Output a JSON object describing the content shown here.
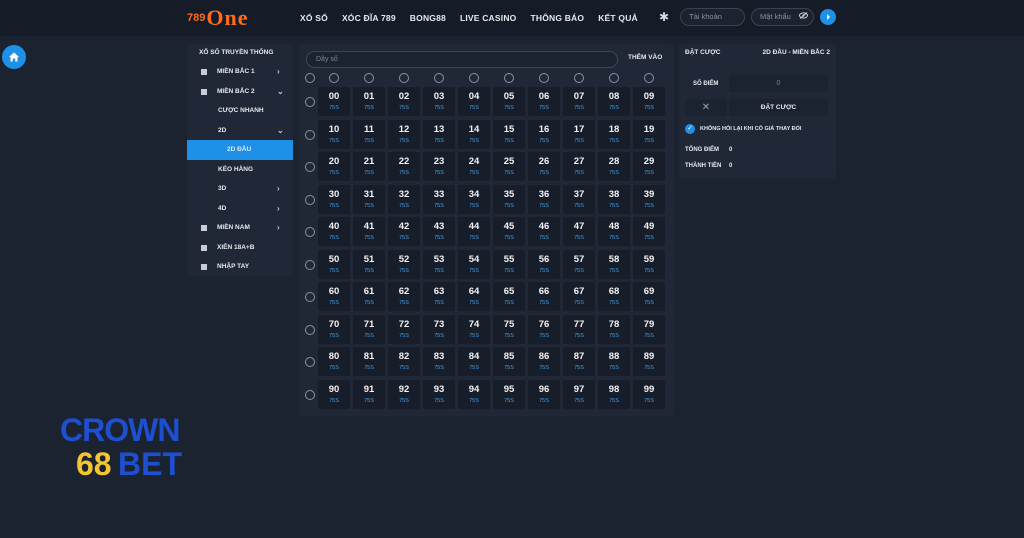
{
  "header": {
    "logo_num": "789",
    "logo_word": "One",
    "nav": [
      "XỔ SỐ",
      "XÓC ĐĨA 789",
      "BONG88",
      "LIVE CASINO",
      "THÔNG BÁO",
      "KẾT QUẢ"
    ],
    "username_placeholder": "Tài khoản",
    "password_placeholder": "Mật khẩu"
  },
  "sidebar": {
    "title": "XỔ SỐ TRUYỀN THỐNG",
    "items": [
      {
        "label": "MIỀN BẮC 1",
        "icon": "square-icon",
        "chevron": "›"
      },
      {
        "label": "MIỀN BẮC 2",
        "icon": "square-icon",
        "chevron": "⌄"
      },
      {
        "label": "CƯỢC NHANH"
      },
      {
        "label": "2D",
        "chevron": "⌄"
      },
      {
        "label": "2D ĐẦU",
        "active": true
      },
      {
        "label": "KÉO HÀNG"
      },
      {
        "label": "3D",
        "chevron": "›"
      },
      {
        "label": "4D",
        "chevron": "›"
      },
      {
        "label": "MIỀN NAM",
        "icon": "square-icon",
        "chevron": "›"
      },
      {
        "label": "XIÊN 18A+B",
        "icon": "square-icon"
      },
      {
        "label": "NHẬP TAY",
        "icon": "square-icon"
      }
    ]
  },
  "grid": {
    "search_placeholder": "Dãy số",
    "add_label": "THÊM VÀO",
    "price": "75S",
    "numbers": [
      "00",
      "01",
      "02",
      "03",
      "04",
      "05",
      "06",
      "07",
      "08",
      "09",
      "10",
      "11",
      "12",
      "13",
      "14",
      "15",
      "16",
      "17",
      "18",
      "19",
      "20",
      "21",
      "22",
      "23",
      "24",
      "25",
      "26",
      "27",
      "28",
      "29",
      "30",
      "31",
      "32",
      "33",
      "34",
      "35",
      "36",
      "37",
      "38",
      "39",
      "40",
      "41",
      "42",
      "43",
      "44",
      "45",
      "46",
      "47",
      "48",
      "49",
      "50",
      "51",
      "52",
      "53",
      "54",
      "55",
      "56",
      "57",
      "58",
      "59",
      "60",
      "61",
      "62",
      "63",
      "64",
      "65",
      "66",
      "67",
      "68",
      "69",
      "70",
      "71",
      "72",
      "73",
      "74",
      "75",
      "76",
      "77",
      "78",
      "79",
      "80",
      "81",
      "82",
      "83",
      "84",
      "85",
      "86",
      "87",
      "88",
      "89",
      "90",
      "91",
      "92",
      "93",
      "94",
      "95",
      "96",
      "97",
      "98",
      "99"
    ]
  },
  "bet": {
    "title": "ĐẶT CƯỢC",
    "mode": "2D ĐẦU - MIỀN BẮC 2",
    "points_label": "SỐ ĐIỂM",
    "points_value": "0",
    "clear_symbol": "✕",
    "place_label": "ĐẶT CƯỢC",
    "check_label": "KHÔNG HỎI LẠI KHI CÓ GIÁ THAY ĐỔI",
    "total_points_label": "TỔNG ĐIỂM",
    "total_points_value": "0",
    "total_money_label": "THÀNH TIỀN",
    "total_money_value": "0"
  },
  "watermark": {
    "line1": "CROWN",
    "line2a": "68",
    "line2b": "BET"
  },
  "colors": {
    "accent": "#1e90e8",
    "logo": "#ff6a1a",
    "background": "#1b2230",
    "panel": "#202838"
  }
}
